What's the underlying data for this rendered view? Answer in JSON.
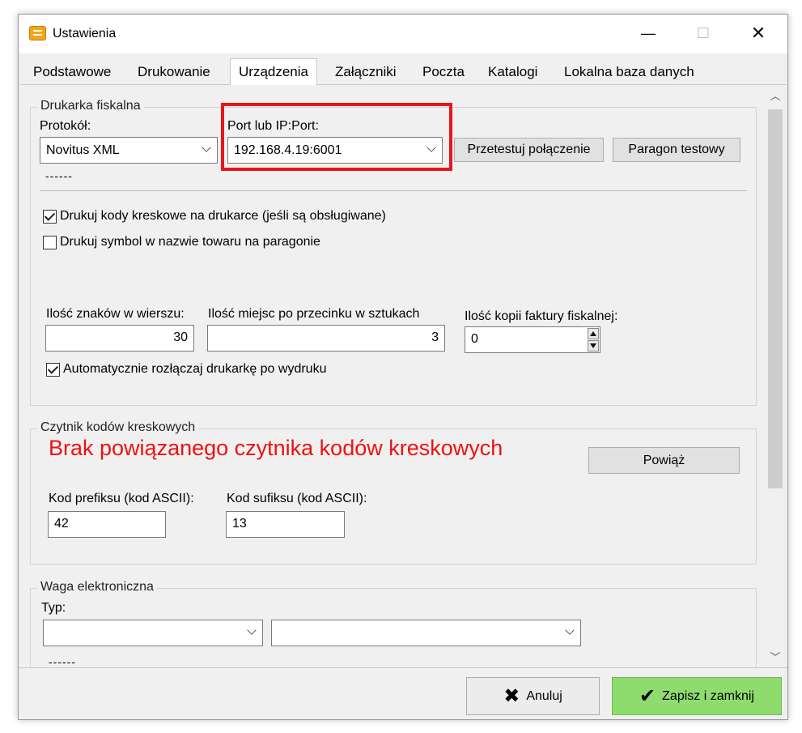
{
  "window": {
    "title": "Ustawienia",
    "icon": "settings-app-icon",
    "controls": {
      "minimize": "—",
      "maximize": "☐",
      "close": "✕"
    }
  },
  "tabs": [
    {
      "label": "Podstawowe",
      "active": false
    },
    {
      "label": "Drukowanie",
      "active": false
    },
    {
      "label": "Urządzenia",
      "active": true
    },
    {
      "label": "Załączniki",
      "active": false
    },
    {
      "label": "Poczta",
      "active": false
    },
    {
      "label": "Katalogi",
      "active": false
    },
    {
      "label": "Lokalna baza danych",
      "active": false
    }
  ],
  "fiscal_printer": {
    "group_title": "Drukarka fiskalna",
    "protocol_label": "Protokół:",
    "protocol_value": "Novitus XML",
    "port_label": "Port lub IP:Port:",
    "port_value": "192.168.4.19:6001",
    "test_connection_button": "Przetestuj połączenie",
    "test_receipt_button": "Paragon testowy",
    "status_text": "------",
    "print_barcodes_label": "Drukuj kody kreskowe na drukarce (jeśli są obsługiwane)",
    "print_barcodes_checked": true,
    "print_symbol_label": "Drukuj symbol w nazwie towaru na paragonie",
    "print_symbol_checked": false,
    "chars_per_line_label": "Ilość znaków w wierszu:",
    "chars_per_line_value": "30",
    "decimal_places_label": "Ilość miejsc po przecinku w sztukach",
    "decimal_places_value": "3",
    "invoice_copies_label": "Ilość kopii faktury fiskalnej:",
    "invoice_copies_value": "0",
    "auto_disconnect_label": "Automatycznie rozłączaj drukarkę po wydruku",
    "auto_disconnect_checked": true
  },
  "barcode_reader": {
    "group_title": "Czytnik kodów kreskowych",
    "status_message": "Brak powiązanego czytnika kodów kreskowych",
    "status_color": "#ee1111",
    "link_button": "Powiąż",
    "prefix_label": "Kod prefiksu (kod ASCII):",
    "prefix_value": "42",
    "suffix_label": "Kod sufiksu (kod ASCII):",
    "suffix_value": "13"
  },
  "scale": {
    "group_title": "Waga elektroniczna",
    "type_label": "Typ:",
    "type_value": "",
    "port_value": "",
    "status_text": "------"
  },
  "footer": {
    "cancel_label": "Anuluj",
    "save_label": "Zapisz i zamknij",
    "save_color": "#8fdc6e"
  },
  "highlight": {
    "color": "#e8161c",
    "target": "port-field"
  }
}
